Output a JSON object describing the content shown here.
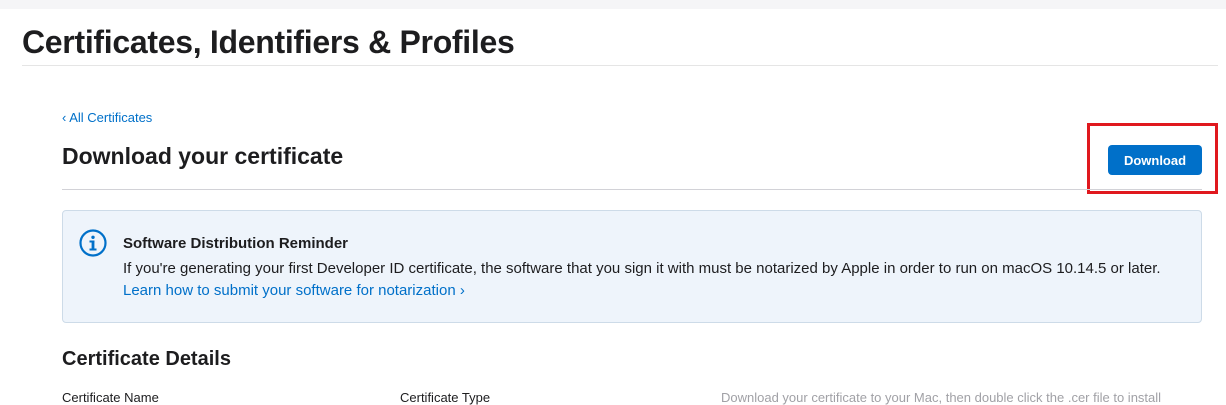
{
  "header": {
    "title": "Certificates, Identifiers & Profiles"
  },
  "nav": {
    "back_link": "‹ All Certificates"
  },
  "main": {
    "heading": "Download your certificate",
    "download_label": "Download"
  },
  "reminder": {
    "icon": "info-icon",
    "title": "Software Distribution Reminder",
    "body": "If you're generating your first Developer ID certificate, the software that you sign it with must be notarized by Apple in order to run on macOS 10.14.5 or later. ",
    "link": "Learn how to submit your software for notarization ›"
  },
  "details": {
    "heading": "Certificate Details",
    "name_label": "Certificate Name",
    "type_label": "Certificate Type",
    "instructions": "Download your certificate to your Mac, then double click the .cer file to install"
  },
  "colors": {
    "accent": "#0070c9",
    "highlight": "#e0181e",
    "banner_background": "#eef4fb"
  }
}
